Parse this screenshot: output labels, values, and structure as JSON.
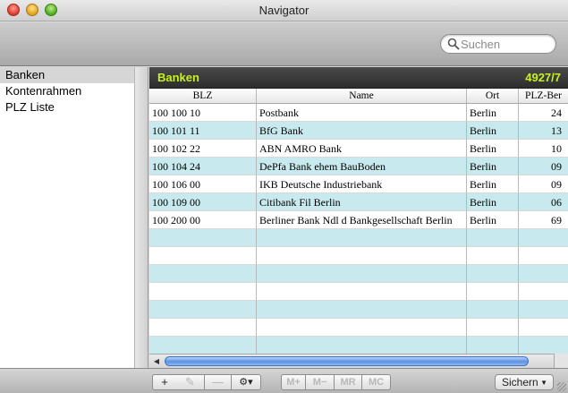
{
  "window": {
    "title": "Navigator"
  },
  "search": {
    "placeholder": "Suchen"
  },
  "sidebar": {
    "items": [
      {
        "label": "Banken",
        "selected": true
      },
      {
        "label": "Kontenrahmen",
        "selected": false
      },
      {
        "label": "PLZ Liste",
        "selected": false
      }
    ]
  },
  "content": {
    "title": "Banken",
    "count": "4927/7"
  },
  "table": {
    "columns": [
      "BLZ",
      "Name",
      "Ort",
      "PLZ-Ber"
    ],
    "rows": [
      {
        "blz": "100 100 10",
        "name": "Postbank",
        "ort": "Berlin",
        "plz": "24"
      },
      {
        "blz": "100 101 11",
        "name": "BfG Bank",
        "ort": "Berlin",
        "plz": "13"
      },
      {
        "blz": "100 102 22",
        "name": "ABN AMRO Bank",
        "ort": "Berlin",
        "plz": "10"
      },
      {
        "blz": "100 104 24",
        "name": "DePfa Bank ehem BauBoden",
        "ort": "Berlin",
        "plz": "09"
      },
      {
        "blz": "100 106 00",
        "name": "IKB Deutsche Industriebank",
        "ort": "Berlin",
        "plz": "09"
      },
      {
        "blz": "100 109 00",
        "name": "Citibank Fil Berlin",
        "ort": "Berlin",
        "plz": "06"
      },
      {
        "blz": "100 200 00",
        "name": "Berliner Bank Ndl d Bankgesellschaft Berlin",
        "ort": "Berlin",
        "plz": "69"
      }
    ]
  },
  "bottombar": {
    "add_label": "+",
    "edit_label": "✎",
    "remove_label": "—",
    "gear_label": "⚙▾",
    "mplus_label": "M+",
    "mminus_label": "M−",
    "mr_label": "MR",
    "mc_label": "MC",
    "save_label": "Sichern"
  },
  "colors": {
    "header_accent": "#c7f21f",
    "row_alt": "#c8eaee",
    "scroll_thumb": "#5b92e5"
  }
}
